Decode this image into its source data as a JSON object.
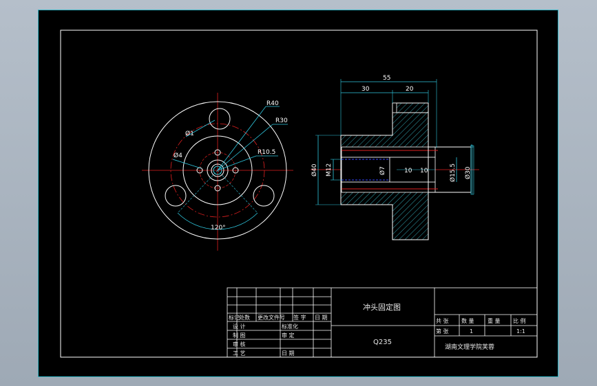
{
  "colors": {
    "background": "#000000",
    "frame": "#ffffff",
    "cyan_dim": "#2fc8e0",
    "red_center": "#e02020",
    "blue_hidden": "#3344ff",
    "hatch": "#3fd0e0"
  },
  "front_view": {
    "dims": {
      "r40": "R40",
      "r30": "R30",
      "r10_5": "R10.5",
      "phi1": "Ø1",
      "phi4": "Ø4",
      "angle": "120°"
    }
  },
  "side_view": {
    "dims": {
      "total_length": "55",
      "left_length": "30",
      "right_length": "20",
      "dia40": "Ø40",
      "m12": "M12",
      "phi7": "Ø7",
      "len_a": "10",
      "len_b": "10",
      "phi15_5": "Ø15.5",
      "dia30": "Ø30"
    }
  },
  "title_block": {
    "drawing_name": "冲头固定图",
    "material": "Q235",
    "school": "湖南文理学院芙蓉",
    "headers": {
      "mark": "标记",
      "count": "处数",
      "change_doc": "更改文件号",
      "signature": "签 字",
      "date": "日 期"
    },
    "rows": {
      "design": "设 计",
      "standardize": "标准化",
      "draw": "制 图",
      "review": "审 定",
      "check": "审 核",
      "process": "工 艺",
      "date2": "日 期"
    },
    "right": {
      "total": "共   张",
      "qty": "数  量",
      "weight": "重  量",
      "scale_label": "比  例",
      "sheet": "第   张",
      "qty_value": "1",
      "scale_value": "1:1"
    }
  }
}
